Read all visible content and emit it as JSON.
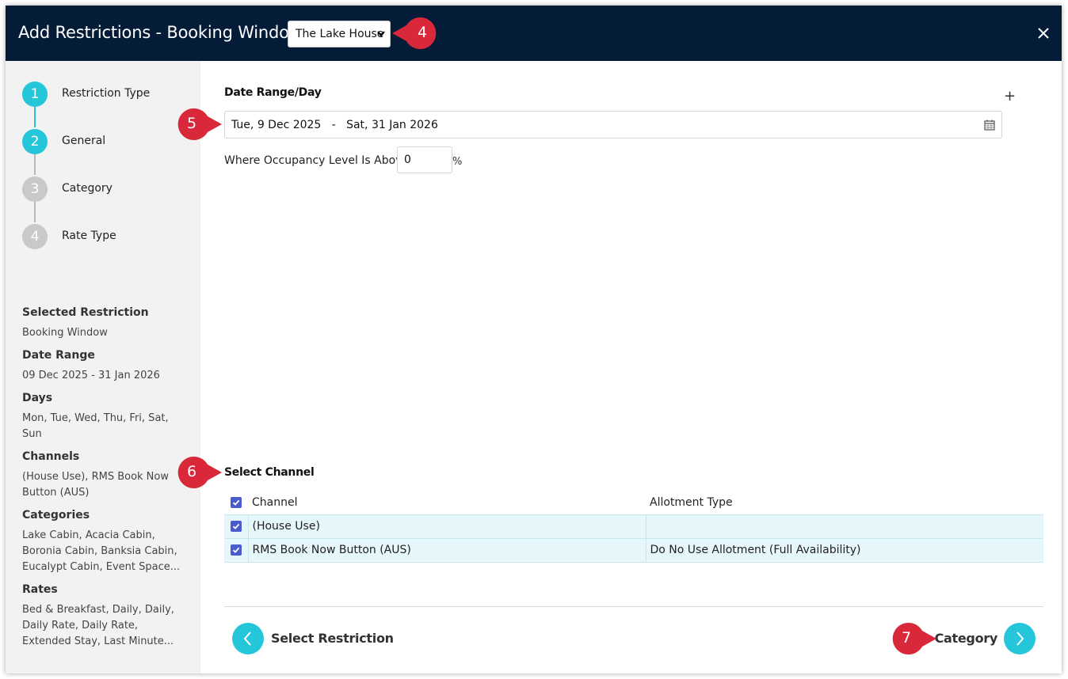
{
  "header": {
    "title": "Add Restrictions - Booking Window",
    "property": "The Lake House"
  },
  "steps": [
    {
      "num": "1",
      "label": "Restriction Type",
      "state": "complete"
    },
    {
      "num": "2",
      "label": "General",
      "state": "current"
    },
    {
      "num": "3",
      "label": "Category",
      "state": "upcoming"
    },
    {
      "num": "4",
      "label": "Rate Type",
      "state": "upcoming"
    }
  ],
  "summary": {
    "selected_restriction_label": "Selected Restriction",
    "selected_restriction_value": "Booking Window",
    "date_range_label": "Date Range",
    "date_range_value": "09 Dec 2025 - 31 Jan 2026",
    "days_label": "Days",
    "days_value": "Mon, Tue, Wed, Thu, Fri, Sat, Sun",
    "channels_label": "Channels",
    "channels_value": "(House Use), RMS Book Now Button (AUS)",
    "categories_label": "Categories",
    "categories_value": "Lake Cabin, Acacia Cabin, Boronia Cabin, Banksia Cabin, Eucalypt Cabin, Event Space...",
    "rates_label": "Rates",
    "rates_value": "Bed & Breakfast, Daily, Daily, Daily Rate, Daily Rate, Extended Stay, Last Minute..."
  },
  "main": {
    "date_range_title": "Date Range/Day",
    "add_symbol": "+",
    "date_range_value": "Tue, 9 Dec 2025   -   Sat, 31 Jan 2026",
    "occupancy_label": "Where Occupancy Level Is Above",
    "occupancy_value": "0",
    "occupancy_unit": "%",
    "select_channel_title": "Select Channel",
    "table": {
      "col_channel": "Channel",
      "col_allotment": "Allotment Type",
      "rows": [
        {
          "channel": "(House Use)",
          "allotment": ""
        },
        {
          "channel": "RMS Book Now Button (AUS)",
          "allotment": "Do No Use Allotment (Full Availability)"
        }
      ]
    }
  },
  "footer": {
    "back_label": "Select Restriction",
    "next_label": "Category"
  },
  "callouts": [
    "4",
    "5",
    "6",
    "7"
  ],
  "colors": {
    "header_bg": "#041c38",
    "accent": "#26c6da",
    "callout": "#d8283a",
    "checkbox": "#4a5bd0",
    "row_bg": "#e6f7fb"
  }
}
